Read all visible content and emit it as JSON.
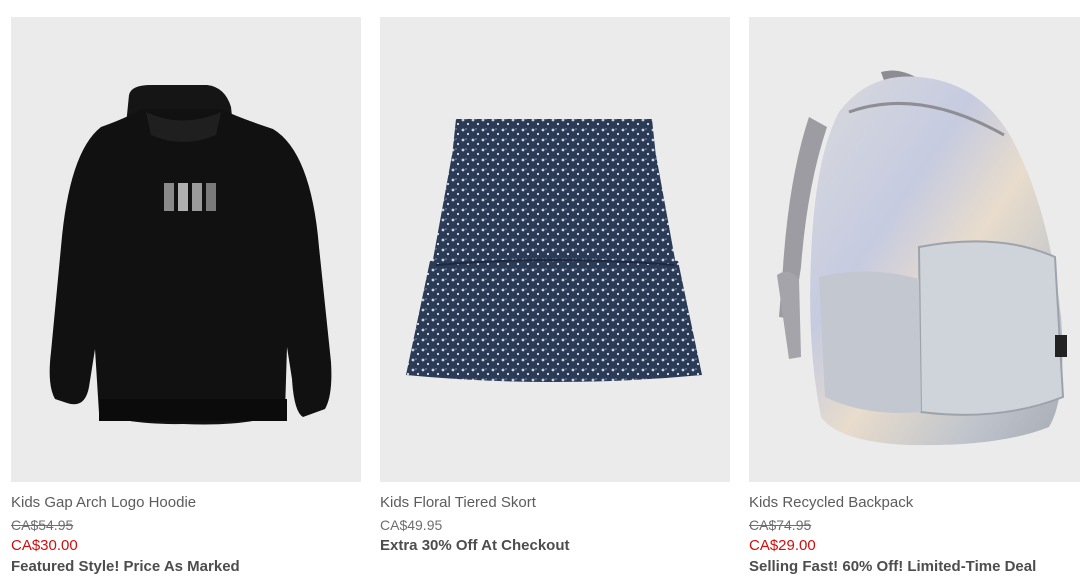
{
  "products": [
    {
      "name": "Kids Gap Arch Logo Hoodie",
      "original_price": "CA$54.95",
      "sale_price": "CA$30.00",
      "promo": "Featured Style! Price As Marked",
      "image_subject": "black hoodie"
    },
    {
      "name": "Kids Floral Tiered Skort",
      "price": "CA$49.95",
      "promo": "Extra 30% Off At Checkout",
      "image_subject": "navy floral skort"
    },
    {
      "name": "Kids Recycled Backpack",
      "original_price": "CA$74.95",
      "sale_price": "CA$29.00",
      "promo": "Selling Fast! 60% Off! Limited-Time Deal",
      "image_subject": "silver iridescent backpack"
    }
  ],
  "colors": {
    "image_background": "#ebebeb",
    "sale_price": "#d10d0d",
    "muted_text": "#6e6e6e"
  }
}
